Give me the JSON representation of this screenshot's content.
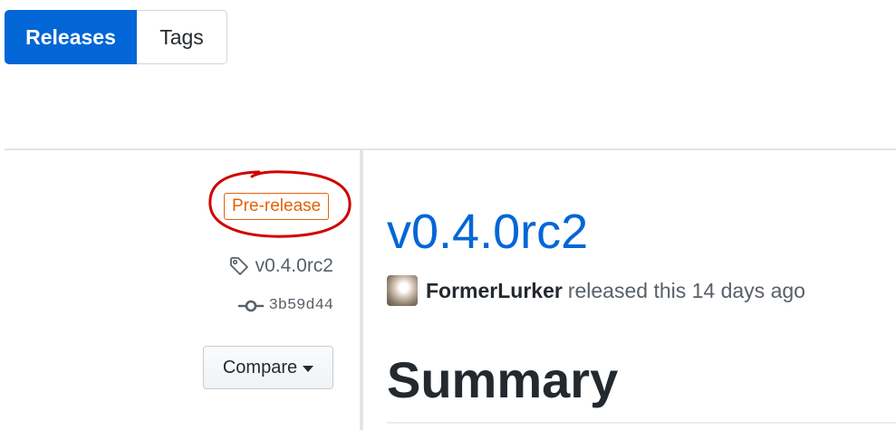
{
  "subnav": {
    "tabs": [
      {
        "label": "Releases",
        "active": true
      },
      {
        "label": "Tags",
        "active": false
      }
    ]
  },
  "release": {
    "badge": "Pre-release",
    "tag": "v0.4.0rc2",
    "commit": "3b59d44",
    "compare_label": "Compare",
    "title": "v0.4.0rc2",
    "author": "FormerLurker",
    "released_text": "released this 14 days ago",
    "section_heading": "Summary"
  },
  "colors": {
    "accent": "#0366d6",
    "prerelease": "#e36209",
    "annotation": "#d00000"
  },
  "icons": {
    "tag": "tag-icon",
    "commit": "git-commit-icon",
    "caret": "caret-down-icon",
    "avatar": "user-avatar"
  }
}
